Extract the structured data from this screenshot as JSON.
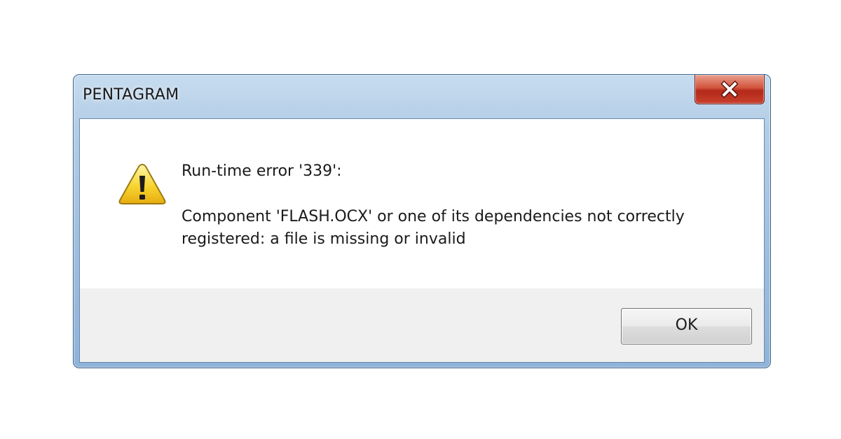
{
  "window": {
    "title": "PENTAGRAM",
    "close_icon": "close-x-icon",
    "close_color": "#c8412d"
  },
  "message": {
    "icon": "warning-triangle-icon",
    "heading": "Run-time error '339':",
    "body": "Component 'FLASH.OCX' or one of its dependencies not correctly registered: a file is missing or invalid"
  },
  "buttons": {
    "ok_label": "OK"
  }
}
